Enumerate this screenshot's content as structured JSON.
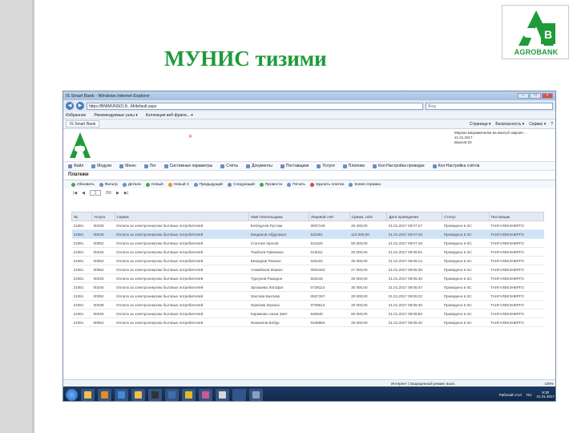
{
  "slide": {
    "title": "МУНИС тизими",
    "logo_text": "AGROBANK"
  },
  "browser": {
    "window_title": "IS Smart Bank - Windows Internet Explorer",
    "address": "https://BNIMUNS01:8...M/default.aspx",
    "search_placeholder": "Bing",
    "favorites_items": [
      "Избранное",
      "Рекомендуемые узлы ▾",
      "Коллекция веб-фрагм... ▾"
    ],
    "tab_label": "IS Smart Bank",
    "cmd_items": [
      "Страница ▾",
      "Безопасность ▾",
      "Сервис ▾",
      "?"
    ],
    "status_text": "Интернет | Защищенный режим: выкл.",
    "zoom": "100%"
  },
  "app": {
    "info_lines": [
      "Марказ маҳкамачилик ва мансуб ижроия ...",
      "21.01.2017",
      "Версия:20"
    ],
    "menu": [
      {
        "label": "Файл",
        "icon": "file-icon"
      },
      {
        "label": "Модули",
        "icon": "modules-icon"
      },
      {
        "label": "Меню",
        "icon": "menu-icon"
      },
      {
        "label": "Лог",
        "icon": "log-icon"
      },
      {
        "label": "Системные параметры",
        "icon": "settings-icon"
      },
      {
        "label": "Счёты",
        "icon": "accounts-icon"
      },
      {
        "label": "Документы",
        "icon": "documents-icon"
      },
      {
        "label": "Поставщики",
        "icon": "suppliers-icon"
      },
      {
        "label": "Услуги",
        "icon": "services-icon"
      },
      {
        "label": "Платежи",
        "icon": "payments-icon"
      },
      {
        "label": "Кол-Настройка проводок",
        "icon": "postings-icon"
      },
      {
        "label": "Кол-Настройка счётов",
        "icon": "account-setup-icon"
      }
    ],
    "panel_title": "Платежи",
    "toolbar": [
      {
        "label": "Обновить",
        "icon": "refresh-icon",
        "color": "#4aa84a"
      },
      {
        "label": "Фильтр",
        "icon": "filter-icon",
        "color": "#6b8fc0"
      },
      {
        "label": "Детали",
        "icon": "details-icon",
        "color": "#6b8fc0"
      },
      {
        "label": "Новый",
        "icon": "new-icon",
        "color": "#4aa84a"
      },
      {
        "label": "Новый 3",
        "icon": "new3-icon",
        "color": "#e09b2d"
      },
      {
        "label": "Предыдущий",
        "icon": "prev-icon",
        "color": "#6b8fc0"
      },
      {
        "label": "Следующий",
        "icon": "next-icon",
        "color": "#6b8fc0"
      },
      {
        "label": "Провести",
        "icon": "post-icon",
        "color": "#4aa84a"
      },
      {
        "label": "Печать",
        "icon": "print-icon",
        "color": "#6b8fc0"
      },
      {
        "label": "Удалить платеж",
        "icon": "delete-icon",
        "color": "#d24a3c"
      },
      {
        "label": "Копия справка",
        "icon": "copy-icon",
        "color": "#6b8fc0"
      }
    ],
    "pager": {
      "page": "1",
      "total": "/56"
    },
    "table": {
      "columns": [
        "№",
        "Услуга",
        "Сервис",
        "Имя Плательщика",
        "Лицевой счёт",
        "Сумма, UZS",
        "Дата проведения",
        "Статус",
        "Поставщик"
      ],
      "rows": [
        [
          "21081",
          "00238",
          "Оплата за электроэнергию бытовых потребителей",
          "Бобоқулов Рустам",
          "0837149",
          "26 200,00",
          "21.01.2017 09:07:27",
          "Проведено в SC",
          "ТАНГАЛЕКЭНЕРГО"
        ],
        [
          "21081",
          "00248",
          "Оплата за электроэнергию бытовых потребителей",
          "Кандинов Абдулазиз",
          "542301",
          "113 000,00",
          "21.01.2017 09:07:43",
          "Проведено в SC",
          "ТАНГАЛЕКЭНЕРГО"
        ],
        [
          "21081",
          "00052",
          "Оплата за электроэнергию бытовых потребителей",
          "Сонтоев Уралов",
          "541520",
          "50 000,00",
          "21.01.2017 09:07:15",
          "Проведено в SC",
          "ТАНГАЛЕКЭНЕРГО"
        ],
        [
          "21081",
          "00245",
          "Оплата за электроэнергию бытовых потребителей",
          "Тожбоев Пайкомон",
          "013011",
          "20 000,00",
          "21.01.2017 09:08:01",
          "Проведено в SC",
          "ТАНГАЛЕКЭНЕРГО"
        ],
        [
          "21081",
          "00052",
          "Оплата за электроэнергию бытовых потребителей",
          "Бекмуров Рахмон",
          "033102",
          "30 000,00",
          "21.01.2017 09:06:14",
          "Проведено в SC",
          "ТАНГАЛЕКЭНЕРГО"
        ],
        [
          "21081",
          "00052",
          "Оплата за электроэнергию бытовых потребителей",
          "Алимбеков Жамол",
          "0004163",
          "27 000,00",
          "21.01.2017 09:05:39",
          "Проведено в SC",
          "ТАНГАЛЕКЭНЕРГО"
        ],
        [
          "21081",
          "00245",
          "Оплата за электроэнергию бытовых потребителей",
          "Турсунов Рахмдон",
          "503415",
          "20 000,00",
          "21.01.2017 09:05:49",
          "Проведено в SC",
          "ТАНГАЛЕКЭНЕРГО"
        ],
        [
          "21081",
          "00245",
          "Оплата за электроэнергию бытовых потребителей",
          "Эргашева Латофат",
          "0738114",
          "30 000,00",
          "21.01.2017 09:05:47",
          "Проведено в SC",
          "ТАНГАЛЕКЭНЕРГО"
        ],
        [
          "21081",
          "00052",
          "Оплата за электроэнергию бытовых потребителей",
          "Зоитова Бахтияр",
          "0537157",
          "20 000,00",
          "21.01.2017 09:05:22",
          "Проведено в SC",
          "ТАНГАЛЕКЭНЕРГО"
        ],
        [
          "21081",
          "00238",
          "Оплата за электроэнергию бытовых потребителей",
          "Орипова Муниса",
          "0736513",
          "20 000,00",
          "21.01.2017 09:06:45",
          "Проведено в SC",
          "ТАНГАЛЕКЭНЕРГО"
        ],
        [
          "21081",
          "00245",
          "Оплата за электроэнергию бытовых потребителей",
          "Каримова Азиза Зиёт",
          "540840",
          "50 000,00",
          "21.01.2017 09:05:50",
          "Проведено в SC",
          "ТАНГАЛЕКЭНЕРГО"
        ],
        [
          "21081",
          "00052",
          "Оплата за электроэнергию бытовых потребителей",
          "Исмоилов Бобур",
          "0436953",
          "20 000,00",
          "21.01.2017 09:05:40",
          "Проведено в SC",
          "ТАНГАЛЕКЭНЕРГО"
        ]
      ],
      "selected_row": 1
    }
  },
  "taskbar": {
    "tray_label": "Рабочий стол",
    "lang": "RU",
    "time": "9:30",
    "date": "21.01.2017",
    "apps": [
      {
        "icon": "folder-icon",
        "color": "#f0c24a"
      },
      {
        "icon": "media-player-icon",
        "color": "#e58a2a"
      },
      {
        "icon": "ie-browser-icon",
        "color": "#3d8ee0"
      },
      {
        "icon": "explorer-icon",
        "color": "#f0c24a"
      },
      {
        "icon": "app-r-icon",
        "color": "#333333"
      },
      {
        "icon": "calculator-icon",
        "color": "#3f6fb0"
      },
      {
        "icon": "chrome-icon",
        "color": "#e0b82d"
      },
      {
        "icon": "paint-icon",
        "color": "#c85a9a"
      },
      {
        "icon": "notes-icon",
        "color": "#d8d8d8"
      },
      {
        "icon": "word-icon",
        "color": "#2b579a"
      },
      {
        "icon": "app-generic-icon",
        "color": "#88a0c0"
      }
    ]
  }
}
